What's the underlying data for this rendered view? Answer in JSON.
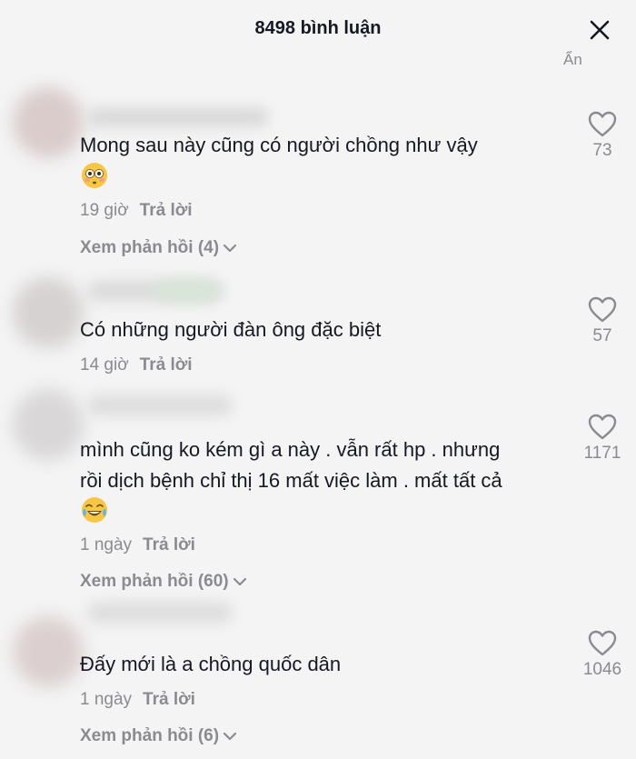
{
  "header": {
    "title": "8498 bình luận"
  },
  "top_clipped_text": "Ẩn",
  "comments": [
    {
      "text": "Mong sau này cũng có người chồng như vậy",
      "emoji": "flushed-face",
      "time": "19 giờ",
      "reply_label": "Trả lời",
      "view_replies": "Xem phản hồi (4)",
      "likes": "73"
    },
    {
      "text": "Có những người đàn ông đặc biệt",
      "time": "14 giờ",
      "reply_label": "Trả lời",
      "likes": "57"
    },
    {
      "text_line1": "mình cũng ko kém gì a này . vẫn rất hp . nhưng",
      "text_line2": "rồi dịch bệnh chỉ thị 16 mất việc làm . mất tất cả",
      "emoji": "tears-of-joy-face",
      "time": "1 ngày",
      "reply_label": "Trả lời",
      "view_replies": "Xem phản hồi (60)",
      "likes": "1171"
    },
    {
      "text": "Đấy mới là a chồng quốc dân",
      "time": "1 ngày",
      "reply_label": "Trả lời",
      "view_replies": "Xem phản hồi (6)",
      "likes": "1046"
    }
  ]
}
